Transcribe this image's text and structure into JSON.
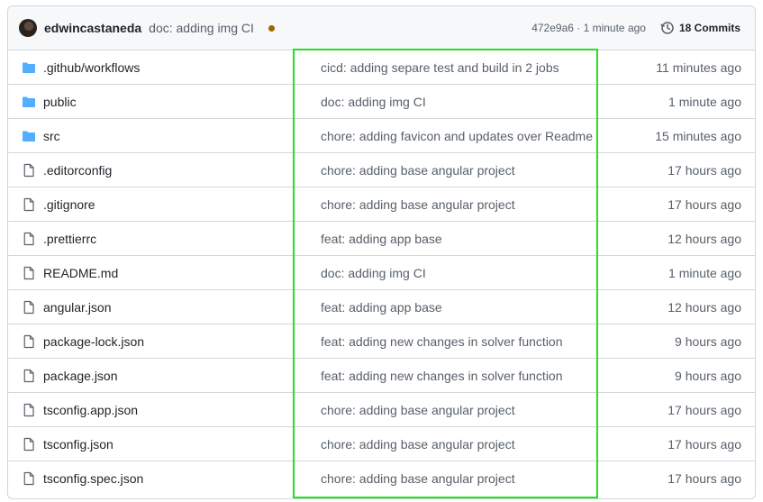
{
  "header": {
    "author": "edwincastaneda",
    "commit_message": "doc: adding img CI",
    "commit_meta": "472e9a6 · 1 minute ago",
    "commits_label": "18 Commits",
    "status_color": "#9a6700"
  },
  "highlight_color": "#22e022",
  "files": [
    {
      "name": ".github/workflows",
      "type": "folder",
      "icon": "folder-icon",
      "message": "cicd: adding separe test and build in 2 jobs",
      "age": "11 minutes ago"
    },
    {
      "name": "public",
      "type": "folder",
      "icon": "folder-icon",
      "message": "doc: adding img CI",
      "age": "1 minute ago"
    },
    {
      "name": "src",
      "type": "folder",
      "icon": "folder-icon",
      "message": "chore: adding favicon and updates over Readme",
      "age": "15 minutes ago"
    },
    {
      "name": ".editorconfig",
      "type": "file",
      "icon": "file-icon",
      "message": "chore: adding base angular project",
      "age": "17 hours ago"
    },
    {
      "name": ".gitignore",
      "type": "file",
      "icon": "file-icon",
      "message": "chore: adding base angular project",
      "age": "17 hours ago"
    },
    {
      "name": ".prettierrc",
      "type": "file",
      "icon": "file-icon",
      "message": "feat: adding app base",
      "age": "12 hours ago"
    },
    {
      "name": "README.md",
      "type": "file",
      "icon": "file-icon",
      "message": "doc: adding img CI",
      "age": "1 minute ago"
    },
    {
      "name": "angular.json",
      "type": "file",
      "icon": "file-icon",
      "message": "feat: adding app base",
      "age": "12 hours ago"
    },
    {
      "name": "package-lock.json",
      "type": "file",
      "icon": "file-icon",
      "message": "feat: adding new changes in solver function",
      "age": "9 hours ago"
    },
    {
      "name": "package.json",
      "type": "file",
      "icon": "file-icon",
      "message": "feat: adding new changes in solver function",
      "age": "9 hours ago"
    },
    {
      "name": "tsconfig.app.json",
      "type": "file",
      "icon": "file-icon",
      "message": "chore: adding base angular project",
      "age": "17 hours ago"
    },
    {
      "name": "tsconfig.json",
      "type": "file",
      "icon": "file-icon",
      "message": "chore: adding base angular project",
      "age": "17 hours ago"
    },
    {
      "name": "tsconfig.spec.json",
      "type": "file",
      "icon": "file-icon",
      "message": "chore: adding base angular project",
      "age": "17 hours ago"
    }
  ]
}
